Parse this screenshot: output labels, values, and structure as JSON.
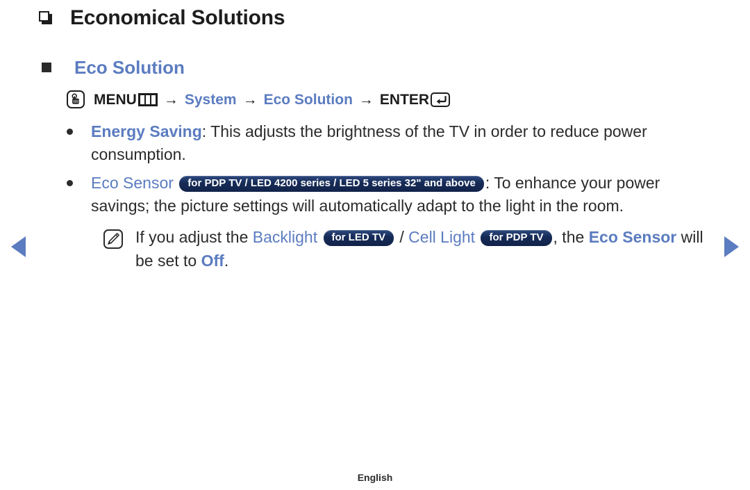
{
  "page": {
    "title": "Economical Solutions",
    "section_heading": "Eco Solution",
    "footer_language": "English"
  },
  "colors": {
    "accent_blue": "#5b7cc0",
    "text_dark": "#2b2b2b",
    "badge_navy": "#162b57",
    "badge_text": "#ffffff"
  },
  "menu_path": {
    "icon": "oo-hand-icon",
    "menu_label": "MENU",
    "menu_icon": "menu-grid-icon",
    "arrow": "→",
    "system_label": "System",
    "eco_solution_label": "Eco Solution",
    "enter_label": "ENTER",
    "enter_icon": "enter-return-icon"
  },
  "bullets": [
    {
      "term": "Energy Saving",
      "separator": ": ",
      "description": "This adjusts the brightness of the TV in order to reduce power consumption."
    },
    {
      "term": "Eco Sensor",
      "badge": "for PDP TV / LED 4200 series / LED 5 series 32\" and above",
      "separator": ": ",
      "description": "To enhance your power savings; the picture settings will automatically adapt to the light in the room."
    }
  ],
  "note": {
    "icon": "note-pencil-icon",
    "part1": "If you adjust the ",
    "backlight_label": "Backlight",
    "badge_led": "for LED TV",
    "slash": " / ",
    "cell_light_label": "Cell Light",
    "badge_pdp": "for PDP TV",
    "part2": ", the ",
    "eco_sensor_label": "Eco Sensor",
    "part3": " will be set to ",
    "off_label": "Off",
    "part4": "."
  },
  "navigation": {
    "prev_label": "◀",
    "next_label": "▶"
  }
}
